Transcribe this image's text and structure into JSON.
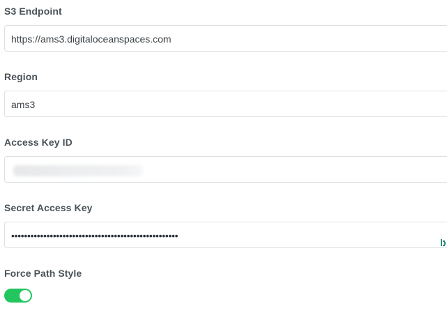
{
  "fields": {
    "endpoint": {
      "label": "S3 Endpoint",
      "value": "https://ams3.digitaloceanspaces.com"
    },
    "region": {
      "label": "Region",
      "value": "ams3"
    },
    "access_key": {
      "label": "Access Key ID",
      "value": ""
    },
    "secret": {
      "label": "Secret Access Key",
      "masked_value": "••••••••••••••••••••••••••••••••••••••••••••••••••••",
      "icon": "reveal-password-icon"
    },
    "force_path": {
      "label": "Force Path Style",
      "enabled": true
    }
  },
  "colors": {
    "label": "#4a5258",
    "border": "#dcdfe3",
    "toggle_on": "#22c55e",
    "icon": "#2b8a7e"
  }
}
